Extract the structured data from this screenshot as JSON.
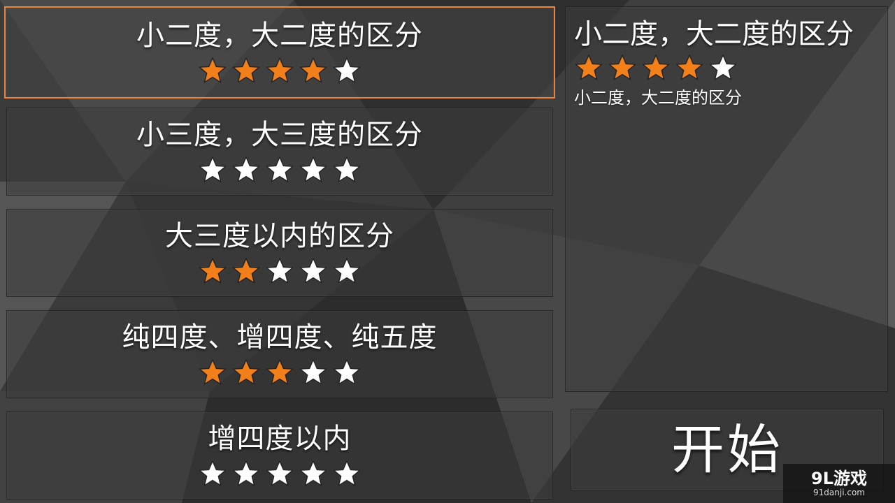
{
  "levels": [
    {
      "title": "小二度，大二度的区分",
      "stars_filled": 4,
      "stars_total": 5,
      "selected": true
    },
    {
      "title": "小三度，大三度的区分",
      "stars_filled": 0,
      "stars_total": 5,
      "selected": false
    },
    {
      "title": "大三度以内的区分",
      "stars_filled": 2,
      "stars_total": 5,
      "selected": false
    },
    {
      "title": "纯四度、增四度、纯五度",
      "stars_filled": 3,
      "stars_total": 5,
      "selected": false
    },
    {
      "title": "增四度以内",
      "stars_filled": 0,
      "stars_total": 5,
      "selected": false
    }
  ],
  "detail": {
    "title": "小二度，大二度的区分",
    "stars_filled": 4,
    "stars_total": 5,
    "description": "小二度，大二度的区分"
  },
  "start_button": {
    "label": "开始"
  },
  "watermark": {
    "main": "9L游戏",
    "sub": "91danji.com"
  },
  "colors": {
    "accent": "#e9843a",
    "star_on": "#f27f1a",
    "star_off": "#ffffff"
  },
  "icons": {
    "star": "star-icon"
  }
}
